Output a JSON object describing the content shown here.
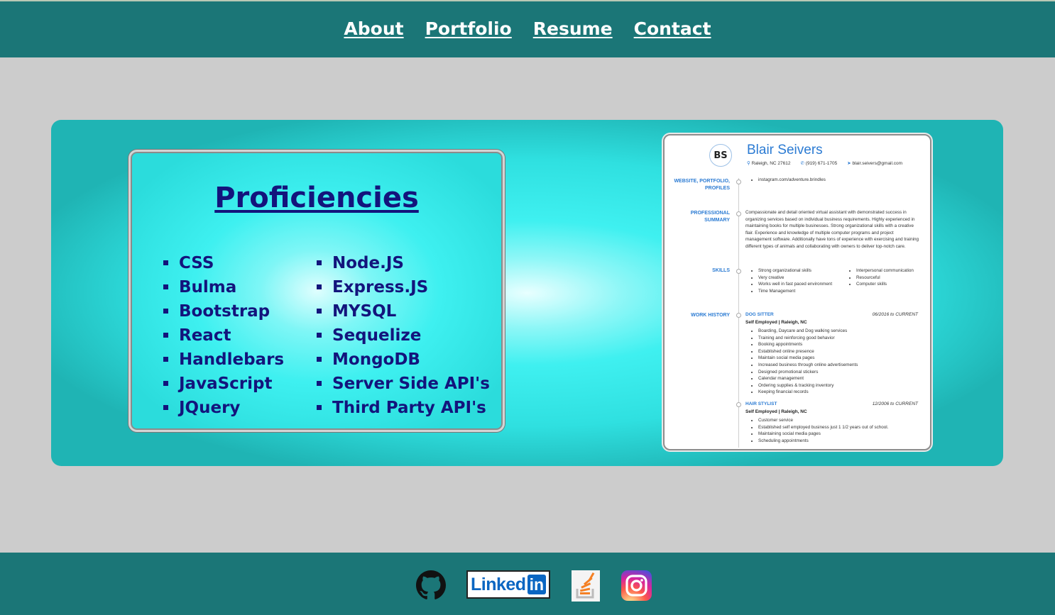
{
  "nav": {
    "about": "About",
    "portfolio": "Portfolio",
    "resume": "Resume",
    "contact": "Contact"
  },
  "proficiencies": {
    "title": "Proficiencies",
    "column1": [
      "CSS",
      "Bulma",
      "Bootstrap",
      "React",
      "Handlebars",
      "JavaScript",
      "JQuery"
    ],
    "column2": [
      "Node.JS",
      "Express.JS",
      "MYSQL",
      "Sequelize",
      "MongoDB",
      "Server Side API's",
      "Third Party API's"
    ]
  },
  "resume": {
    "initials": "BS",
    "name": "Blair Seivers",
    "location": "Raleigh, NC 27612",
    "phone": "(919) 671-1705",
    "email": "blair.seivers@gmail.com",
    "sections": {
      "website": "WEBSITE, PORTFOLIO, PROFILES",
      "summary": "PROFESSIONAL SUMMARY",
      "skills": "SKILLS",
      "work": "WORK HISTORY"
    },
    "website_item": "instagram.com/adventure.brindles",
    "summary_text": "Compassionate and detail oriented virtual assistant with demonstrated success in organizing services based on individual business requirements. Highly experienced in maintaining books for multiple businesses. Strong organizational skills with a creative flair. Experience and knowledge of multiple computer programs and project management software. Additionally have tons of experience with exercising and training different types of animals and collaborating with owners to deliver top-notch care.",
    "skills_col1": [
      "Strong organizational skills",
      "Very creative",
      "Works well in fast paced environment",
      "Time Management"
    ],
    "skills_col2": [
      "Interpersonal communication",
      "Resourceful",
      "Computer skills"
    ],
    "job1": {
      "title": "DOG SITTER",
      "dates": "06/2016 to CURRENT",
      "employer": "Self Employed | Raleigh, NC",
      "items": [
        "Boarding, Daycare and Dog walking services",
        "Training and reinforcing good behavior",
        "Booking appointments",
        "Established online presence",
        "Maintain social media pages",
        "Increased business through online advertisements",
        "Designed promotional stickers",
        "Calendar management",
        "Ordering supplies & tracking inventory",
        "Keeping financial records"
      ]
    },
    "job2": {
      "title": "HAIR STYLIST",
      "dates": "12/2006 to CURRENT",
      "employer": "Self Employed | Raleigh, NC",
      "items": [
        "Customer service",
        "Established self employed business just 1 1/2 years out of school.",
        "Maintaining social media pages",
        "Scheduling appointments"
      ]
    }
  },
  "footer": {
    "linkedin_text": "Linked",
    "linkedin_in": "in",
    "icons": [
      "github-icon",
      "linkedin-icon",
      "stackoverflow-icon",
      "instagram-icon"
    ]
  },
  "colors": {
    "header_bg": "#1b7677",
    "page_bg": "#cccccc",
    "proficiency_text": "#13147c",
    "resume_accent": "#2b7bd3"
  }
}
